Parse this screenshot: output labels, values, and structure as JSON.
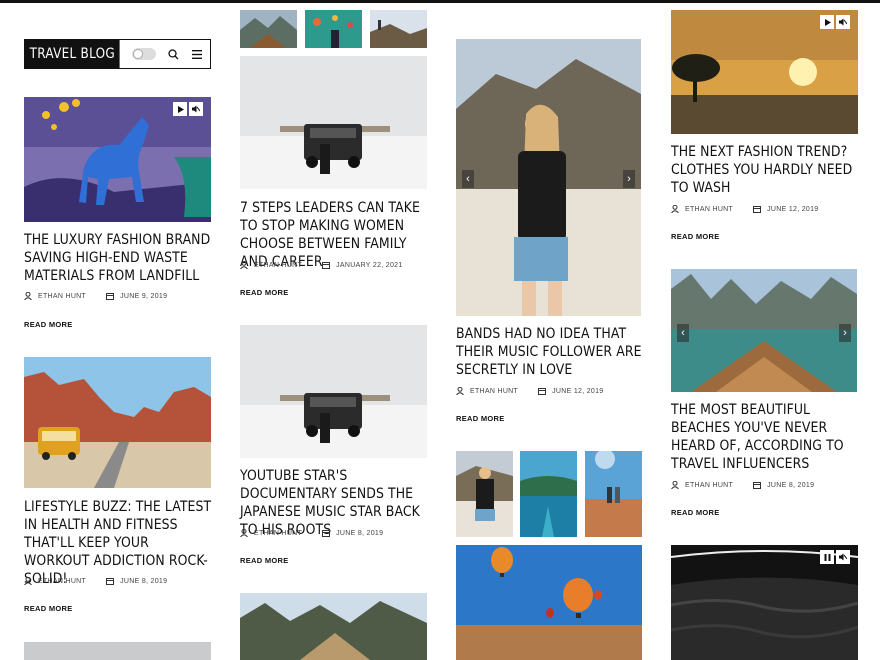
{
  "header": {
    "logo": "TRAVEL BLOG",
    "icons": [
      "toggle-switch",
      "search-icon",
      "menu-icon"
    ]
  },
  "col1": {
    "post1": {
      "title": "THE LUXURY FASHION BRAND SAVING HIGH-END WASTE MATERIALS FROM LANDFILL",
      "author": "ETHAN HUNT",
      "date": "JUNE 9, 2019",
      "read_more": "READ MORE"
    },
    "post2": {
      "title": "LIFESTYLE BUZZ: THE LATEST IN HEALTH AND FITNESS THAT'LL KEEP YOUR WORKOUT ADDICTION ROCK-SOLID!",
      "author": "ETHAN HUNT",
      "date": "JUNE 8, 2019",
      "read_more": "READ MORE"
    }
  },
  "col2": {
    "post1": {
      "title": "7 STEPS LEADERS CAN TAKE TO STOP MAKING WOMEN CHOOSE BETWEEN FAMILY AND CAREER",
      "author": "ETHAN HUNT",
      "date": "JANUARY 22, 2021",
      "read_more": "READ MORE"
    },
    "post2": {
      "title": "YOUTUBE STAR'S DOCUMENTARY SENDS THE JAPANESE MUSIC STAR BACK TO HIS ROOTS",
      "author": "ETHAN HUNT",
      "date": "JUNE 8, 2019",
      "read_more": "READ MORE"
    }
  },
  "col3": {
    "post1": {
      "title": "BANDS HAD NO IDEA THAT THEIR MUSIC FOLLOWER ARE SECRETLY IN LOVE",
      "author": "ETHAN HUNT",
      "date": "JUNE 12, 2019",
      "read_more": "READ MORE"
    }
  },
  "col4": {
    "post1": {
      "title": "THE NEXT FASHION TREND? CLOTHES YOU HARDLY NEED TO WASH",
      "author": "ETHAN HUNT",
      "date": "JUNE 12, 2019",
      "read_more": "READ MORE"
    },
    "post2": {
      "title": "THE MOST BEAUTIFUL BEACHES YOU'VE NEVER HEARD OF, ACCORDING TO TRAVEL INFLUENCERS",
      "author": "ETHAN HUNT",
      "date": "JUNE 8, 2019",
      "read_more": "READ MORE"
    }
  },
  "colors": {
    "text": "#111111",
    "meta": "#444444",
    "logo_bg": "#111111"
  }
}
